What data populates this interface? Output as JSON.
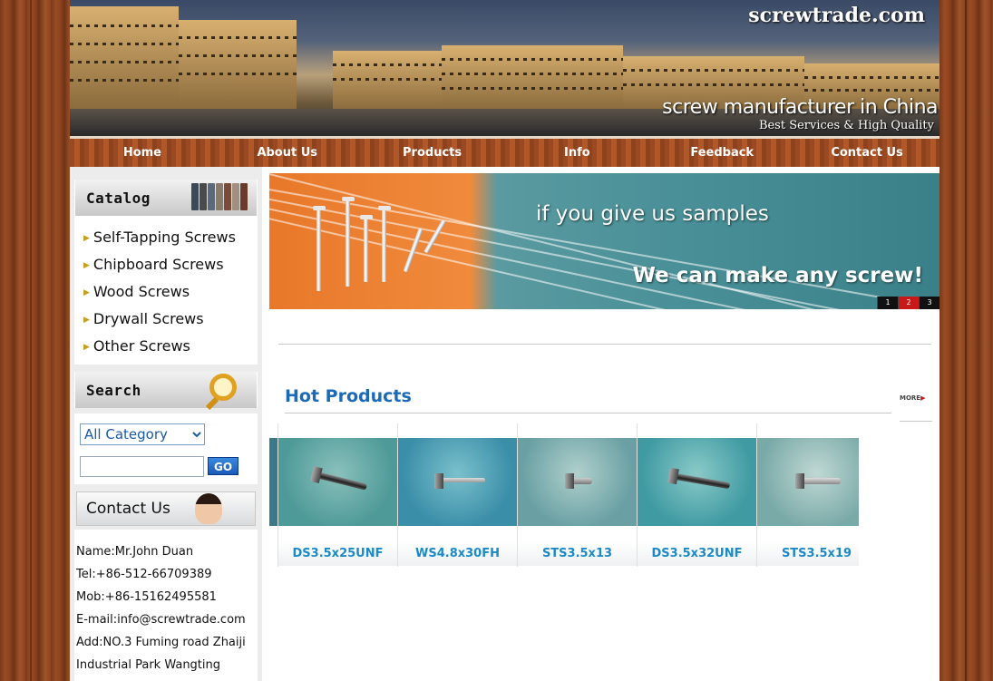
{
  "header": {
    "site_name": "screwtrade.com",
    "tagline": "screw manufacturer in China",
    "subtagline": "Best Services & High Quality"
  },
  "nav": {
    "items": [
      {
        "label": "Home"
      },
      {
        "label": "About Us"
      },
      {
        "label": "Products"
      },
      {
        "label": "Info"
      },
      {
        "label": "Feedback"
      },
      {
        "label": "Contact Us"
      }
    ]
  },
  "catalog": {
    "heading": "Catalog",
    "items": [
      {
        "label": "Self-Tapping Screws"
      },
      {
        "label": "Chipboard Screws"
      },
      {
        "label": "Wood Screws"
      },
      {
        "label": "Drywall Screws"
      },
      {
        "label": "Other Screws"
      }
    ]
  },
  "search": {
    "heading": "Search",
    "category_selected": "All Category",
    "input_value": "",
    "go_label": "GO"
  },
  "contact": {
    "heading": "Contact Us",
    "lines": [
      "Name:Mr.John Duan",
      "Tel:+86-512-66709389",
      "Mob:+86-15162495581",
      "E-mail:info@screwtrade.com",
      "Add:NO.3 Fuming road Zhaiji",
      "Industrial Park Wangting"
    ]
  },
  "slideshow": {
    "text_top": "if you give us samples",
    "text_bottom": "We can make any screw!",
    "pages": [
      "1",
      "2",
      "3"
    ],
    "active_page": "2"
  },
  "hot_products": {
    "title": "Hot Products",
    "more_label": "MORE",
    "items": [
      {
        "label": "DS3.5x25UNF",
        "bg": "#4e9a98"
      },
      {
        "label": "WS4.8x30FH",
        "bg": "#3a8ea8"
      },
      {
        "label": "STS3.5x13",
        "bg": "#6aa0a4"
      },
      {
        "label": "DS3.5x32UNF",
        "bg": "#3f9aa2"
      },
      {
        "label": "STS3.5x19",
        "bg": "#7aaaa8"
      }
    ]
  },
  "colors": {
    "nav_wood": "#a0522d",
    "link_blue": "#1a8ac8",
    "title_blue": "#1a6ab8"
  }
}
